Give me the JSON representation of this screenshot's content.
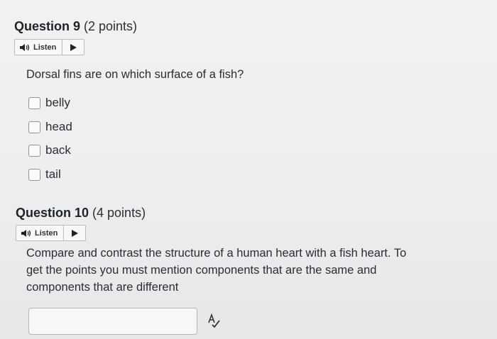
{
  "q9": {
    "title_bold": "Question 9",
    "points": " (2 points)",
    "listen_label": "Listen",
    "prompt": "Dorsal fins are on which surface of a fish?",
    "options": [
      "belly",
      "head",
      "back",
      "tail"
    ]
  },
  "q10": {
    "title_bold": "Question 10",
    "points": " (4 points)",
    "listen_label": "Listen",
    "prompt_lines": [
      "Compare and contrast the structure of a human heart with a fish heart. To",
      "get the points you must mention components that are the same and",
      "components that are different"
    ]
  },
  "icons": {
    "speaker": "speaker-icon",
    "play": "play-icon",
    "spellcheck": "spellcheck-icon"
  }
}
